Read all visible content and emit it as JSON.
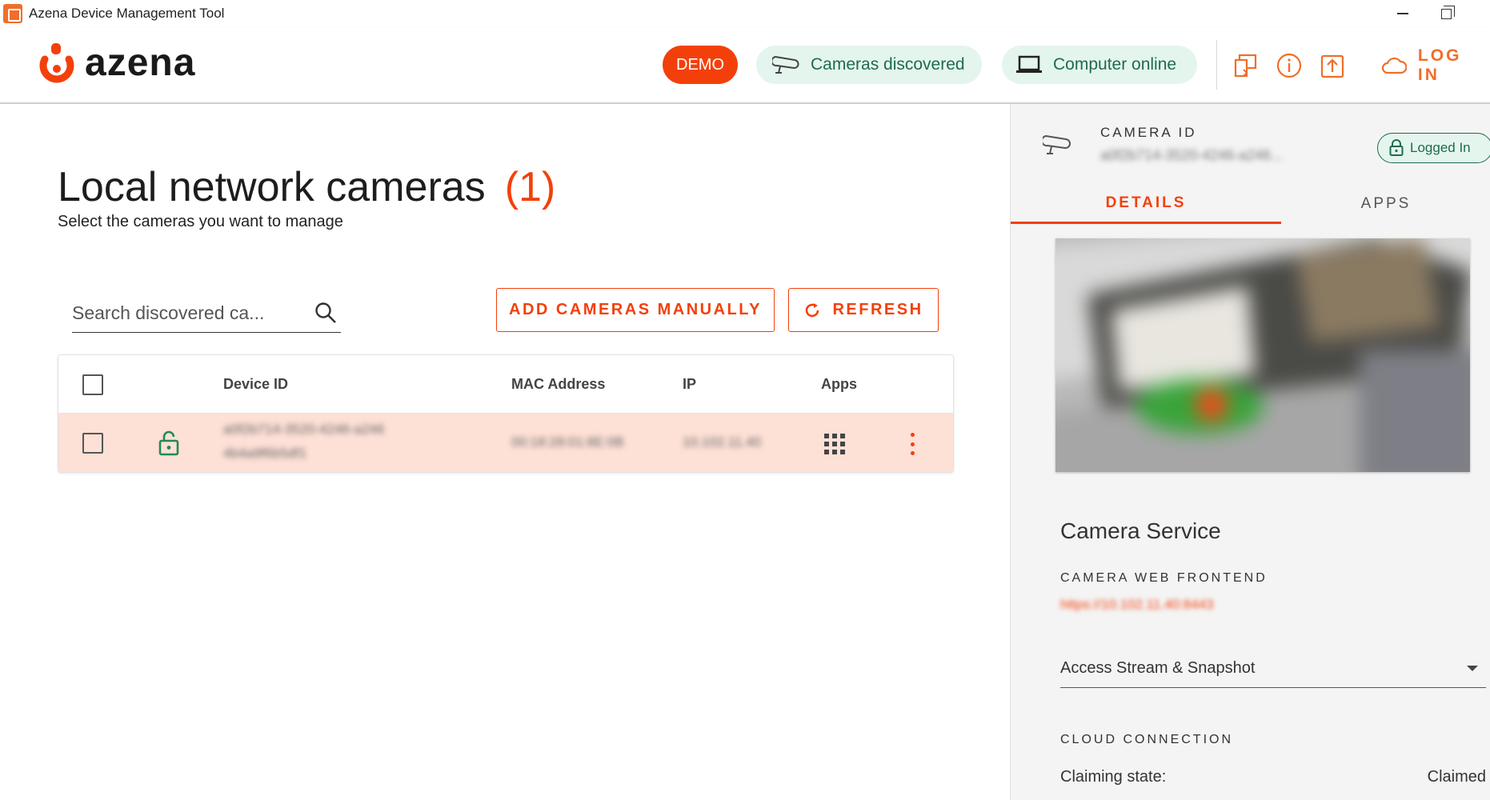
{
  "window": {
    "title": "Azena Device Management Tool",
    "icon": "azena-app-icon"
  },
  "header": {
    "logo_text": "azena",
    "demo_label": "DEMO",
    "cameras_discovered_label": "Cameras discovered",
    "computer_online_label": "Computer online",
    "login_label": "LOG IN",
    "icons": [
      "cast-icon",
      "info-icon",
      "upload-icon",
      "cloud-icon"
    ]
  },
  "main": {
    "title": "Local network cameras",
    "count": "(1)",
    "subtitle": "Select the cameras you want to manage",
    "search_placeholder": "Search discovered ca...",
    "add_button": "ADD CAMERAS MANUALLY",
    "refresh_button": "REFRESH",
    "table": {
      "columns": [
        "Device ID",
        "MAC Address",
        "IP",
        "Apps"
      ],
      "rows": [
        {
          "device_id_line1": "a0f2b714-3520-4246-a246",
          "device_id_line2": "4b4a9f6b5df1",
          "mac": "00:18:28:01:8E:0B",
          "ip": "10.102.11.40",
          "locked": true
        }
      ]
    }
  },
  "panel": {
    "camera_id_label": "CAMERA ID",
    "camera_id_value": "a0f2b714-3520-4246-a246...",
    "logged_in_label": "Logged In",
    "tabs": [
      "DETAILS",
      "APPS"
    ],
    "active_tab": "DETAILS",
    "service_title": "Camera Service",
    "web_frontend_label": "CAMERA WEB FRONTEND",
    "web_frontend_url": "https://10.102.11.40:8443",
    "access_select": "Access Stream & Snapshot",
    "cloud_label": "CLOUD CONNECTION",
    "claiming_label": "Claiming state:",
    "claiming_value": "Claimed"
  },
  "colors": {
    "accent": "#f3400b",
    "accent_soft": "#f06e2a",
    "success": "#1f6b4b",
    "success_bg": "#e4f5ee",
    "row_highlight": "#fde0d6"
  }
}
